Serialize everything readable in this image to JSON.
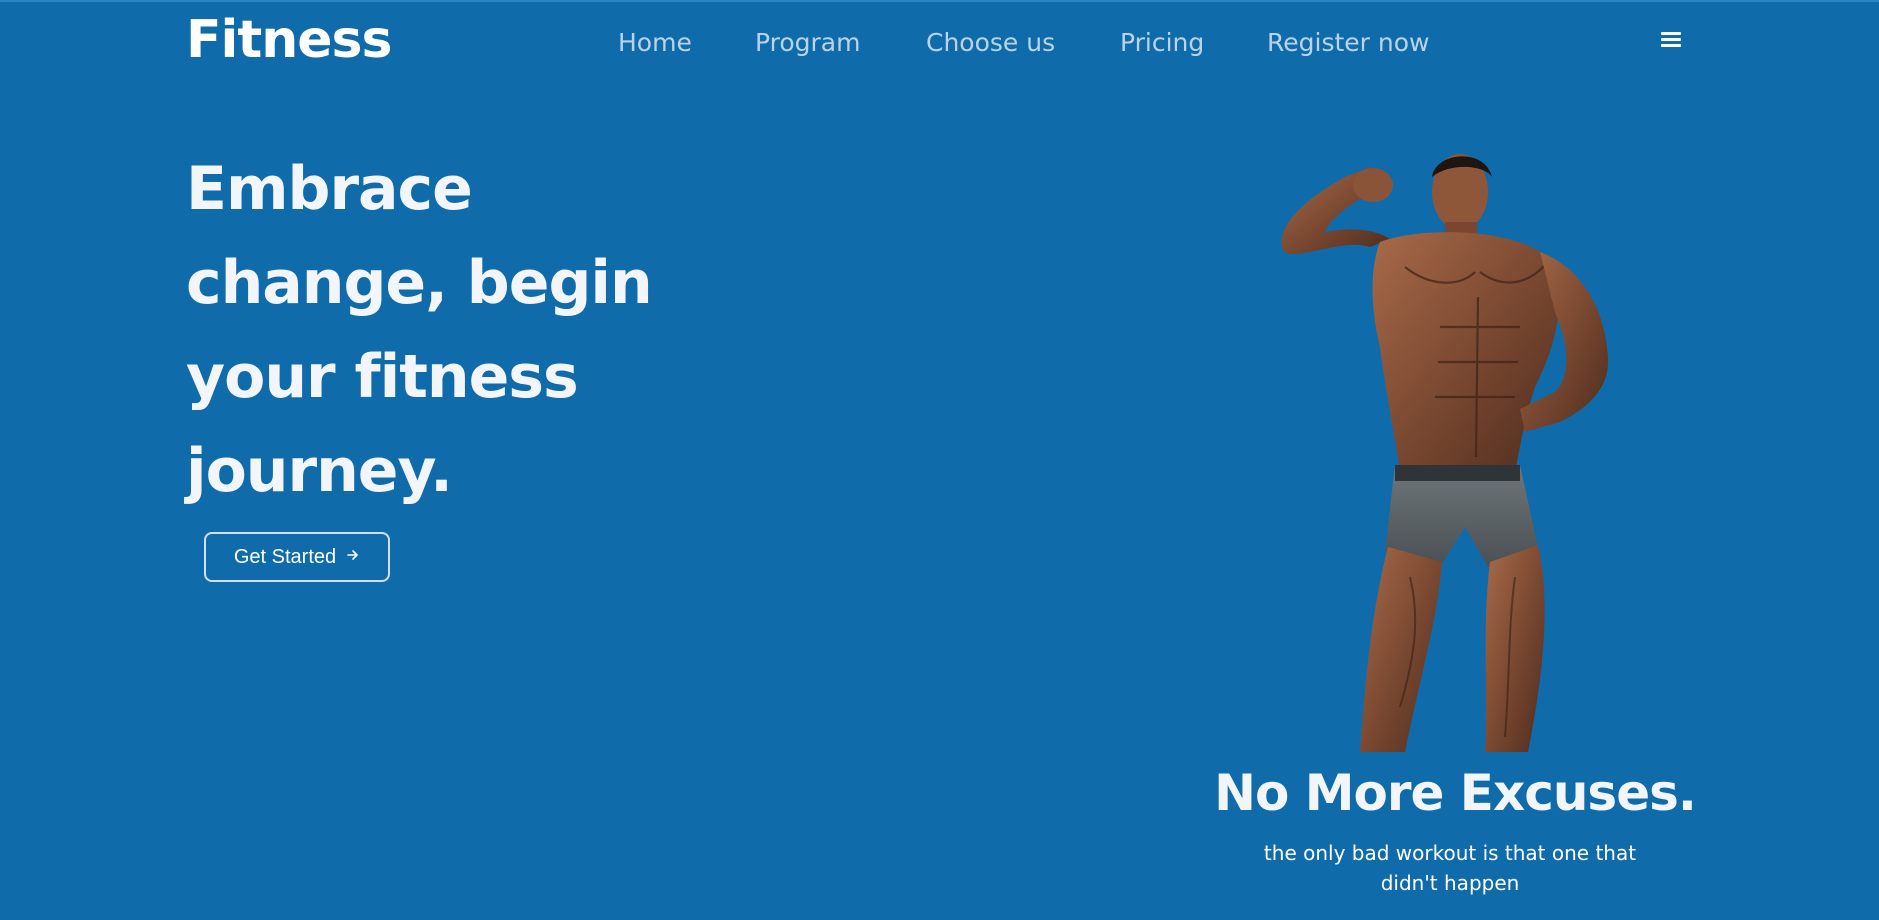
{
  "brand": {
    "logo": "Fitness"
  },
  "nav": {
    "items": [
      {
        "label": "Home"
      },
      {
        "label": "Program"
      },
      {
        "label": "Choose us"
      },
      {
        "label": "Pricing"
      },
      {
        "label": "Register now"
      }
    ],
    "menu_icon": "hamburger-menu-icon"
  },
  "hero": {
    "title": "Embrace change, begin your fitness journey.",
    "cta_label": "Get Started",
    "cta_icon": "arrow-right-icon"
  },
  "showcase": {
    "image": "flexing-bodybuilder-image",
    "headline": "No More Excuses.",
    "subline": "the only bad workout is that one that didn't happen"
  },
  "colors": {
    "background": "#106bab",
    "nav_text": "#b9d3ea",
    "heading_text": "#f2f6fb",
    "button_border": "#cfe0ee"
  }
}
